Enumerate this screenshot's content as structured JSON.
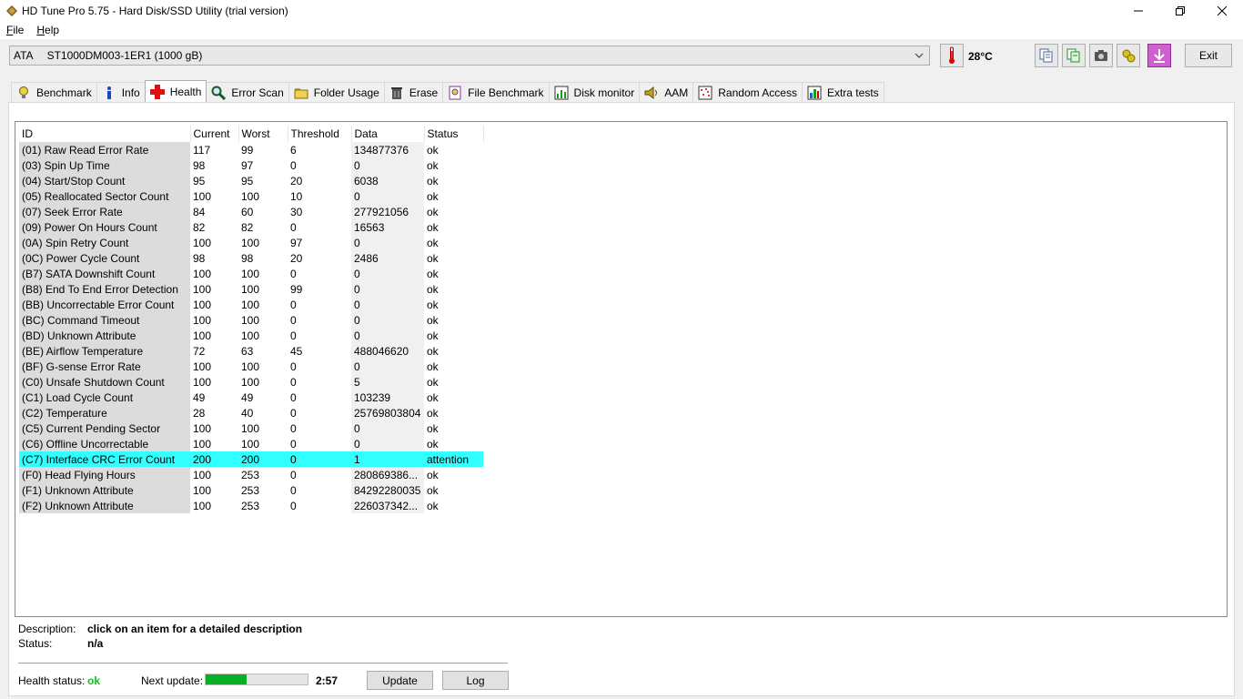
{
  "window": {
    "title": "HD Tune Pro 5.75 - Hard Disk/SSD Utility (trial version)"
  },
  "menu": {
    "file": "File",
    "file_key": "F",
    "file_rest": "ile",
    "help": "Help",
    "help_key": "H",
    "help_rest": "elp"
  },
  "drive": {
    "bus": "ATA",
    "name": "ST1000DM003-1ER1 (1000 gB)"
  },
  "temperature": "28°C",
  "exit_label": "Exit",
  "tabs": [
    {
      "label": "Benchmark",
      "icon": "lightbulb-icon"
    },
    {
      "label": "Info",
      "icon": "info-icon"
    },
    {
      "label": "Health",
      "icon": "red-cross-icon",
      "active": true
    },
    {
      "label": "Error Scan",
      "icon": "magnifier-icon"
    },
    {
      "label": "Folder Usage",
      "icon": "folder-icon"
    },
    {
      "label": "Erase",
      "icon": "trash-icon"
    },
    {
      "label": "File Benchmark",
      "icon": "file-benchmark-icon"
    },
    {
      "label": "Disk monitor",
      "icon": "chart-icon"
    },
    {
      "label": "AAM",
      "icon": "speaker-icon"
    },
    {
      "label": "Random Access",
      "icon": "random-access-icon"
    },
    {
      "label": "Extra tests",
      "icon": "extra-tests-icon"
    }
  ],
  "table": {
    "headers": {
      "id": "ID",
      "current": "Current",
      "worst": "Worst",
      "threshold": "Threshold",
      "data": "Data",
      "status": "Status"
    },
    "rows": [
      {
        "id": "(01) Raw Read Error Rate",
        "current": "117",
        "worst": "99",
        "threshold": "6",
        "data": "134877376",
        "status": "ok"
      },
      {
        "id": "(03) Spin Up Time",
        "current": "98",
        "worst": "97",
        "threshold": "0",
        "data": "0",
        "status": "ok"
      },
      {
        "id": "(04) Start/Stop Count",
        "current": "95",
        "worst": "95",
        "threshold": "20",
        "data": "6038",
        "status": "ok"
      },
      {
        "id": "(05) Reallocated Sector Count",
        "current": "100",
        "worst": "100",
        "threshold": "10",
        "data": "0",
        "status": "ok"
      },
      {
        "id": "(07) Seek Error Rate",
        "current": "84",
        "worst": "60",
        "threshold": "30",
        "data": "277921056",
        "status": "ok"
      },
      {
        "id": "(09) Power On Hours Count",
        "current": "82",
        "worst": "82",
        "threshold": "0",
        "data": "16563",
        "status": "ok"
      },
      {
        "id": "(0A) Spin Retry Count",
        "current": "100",
        "worst": "100",
        "threshold": "97",
        "data": "0",
        "status": "ok"
      },
      {
        "id": "(0C) Power Cycle Count",
        "current": "98",
        "worst": "98",
        "threshold": "20",
        "data": "2486",
        "status": "ok"
      },
      {
        "id": "(B7) SATA Downshift Count",
        "current": "100",
        "worst": "100",
        "threshold": "0",
        "data": "0",
        "status": "ok"
      },
      {
        "id": "(B8) End To End Error Detection",
        "current": "100",
        "worst": "100",
        "threshold": "99",
        "data": "0",
        "status": "ok"
      },
      {
        "id": "(BB) Uncorrectable Error Count",
        "current": "100",
        "worst": "100",
        "threshold": "0",
        "data": "0",
        "status": "ok"
      },
      {
        "id": "(BC) Command Timeout",
        "current": "100",
        "worst": "100",
        "threshold": "0",
        "data": "0",
        "status": "ok"
      },
      {
        "id": "(BD) Unknown Attribute",
        "current": "100",
        "worst": "100",
        "threshold": "0",
        "data": "0",
        "status": "ok"
      },
      {
        "id": "(BE) Airflow Temperature",
        "current": "72",
        "worst": "63",
        "threshold": "45",
        "data": "488046620",
        "status": "ok"
      },
      {
        "id": "(BF) G-sense Error Rate",
        "current": "100",
        "worst": "100",
        "threshold": "0",
        "data": "0",
        "status": "ok"
      },
      {
        "id": "(C0) Unsafe Shutdown Count",
        "current": "100",
        "worst": "100",
        "threshold": "0",
        "data": "5",
        "status": "ok"
      },
      {
        "id": "(C1) Load Cycle Count",
        "current": "49",
        "worst": "49",
        "threshold": "0",
        "data": "103239",
        "status": "ok"
      },
      {
        "id": "(C2) Temperature",
        "current": "28",
        "worst": "40",
        "threshold": "0",
        "data": "25769803804",
        "status": "ok"
      },
      {
        "id": "(C5) Current Pending Sector",
        "current": "100",
        "worst": "100",
        "threshold": "0",
        "data": "0",
        "status": "ok"
      },
      {
        "id": "(C6) Offline Uncorrectable",
        "current": "100",
        "worst": "100",
        "threshold": "0",
        "data": "0",
        "status": "ok"
      },
      {
        "id": "(C7) Interface CRC Error Count",
        "current": "200",
        "worst": "200",
        "threshold": "0",
        "data": "1",
        "status": "attention",
        "highlight": true
      },
      {
        "id": "(F0) Head Flying Hours",
        "current": "100",
        "worst": "253",
        "threshold": "0",
        "data": "280869386...",
        "status": "ok"
      },
      {
        "id": "(F1) Unknown Attribute",
        "current": "100",
        "worst": "253",
        "threshold": "0",
        "data": "84292280035",
        "status": "ok"
      },
      {
        "id": "(F2) Unknown Attribute",
        "current": "100",
        "worst": "253",
        "threshold": "0",
        "data": "226037342...",
        "status": "ok"
      }
    ]
  },
  "description": {
    "label": "Description:",
    "value": "click on an item for a detailed description"
  },
  "status": {
    "label": "Status:",
    "value": "n/a"
  },
  "health": {
    "label": "Health status:",
    "value": "ok",
    "color": "#12c312"
  },
  "next_update": {
    "label": "Next update:",
    "progress": 0.4,
    "time": "2:57"
  },
  "buttons": {
    "update": "Update",
    "log": "Log"
  },
  "colors": {
    "highlight": "#33ffff",
    "progress": "#06b025"
  }
}
